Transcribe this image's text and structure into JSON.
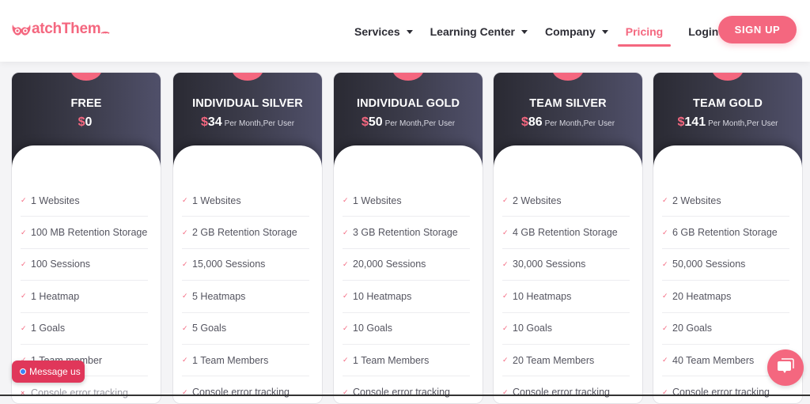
{
  "header": {
    "logo_text": "atchThem",
    "nav": [
      {
        "label": "Services",
        "has_dropdown": true,
        "active": false
      },
      {
        "label": "Learning Center",
        "has_dropdown": true,
        "active": false
      },
      {
        "label": "Company",
        "has_dropdown": true,
        "active": false
      },
      {
        "label": "Pricing",
        "has_dropdown": false,
        "active": true
      },
      {
        "label": "Login",
        "has_dropdown": false,
        "active": false
      }
    ],
    "signup_label": "SIGN UP"
  },
  "colors": {
    "accent": "#f4677f",
    "card_header_dark": "#2a2a33",
    "card_header_light": "#50506a",
    "message_button": "#e0375a"
  },
  "plans": [
    {
      "title": "FREE",
      "currency": "$",
      "price": "0",
      "period": "",
      "features": [
        {
          "text": "1 Websites",
          "included": true
        },
        {
          "text": "100 MB Retention Storage",
          "included": true
        },
        {
          "text": "100 Sessions",
          "included": true
        },
        {
          "text": "1 Heatmap",
          "included": true
        },
        {
          "text": "1 Goals",
          "included": true
        },
        {
          "text": "1 Team member",
          "included": true
        },
        {
          "text": "Console error tracking",
          "included": false
        }
      ]
    },
    {
      "title": "INDIVIDUAL SILVER",
      "currency": "$",
      "price": "34",
      "period": "Per Month,Per User",
      "features": [
        {
          "text": "1 Websites",
          "included": true
        },
        {
          "text": "2 GB Retention Storage",
          "included": true
        },
        {
          "text": "15,000 Sessions",
          "included": true
        },
        {
          "text": "5 Heatmaps",
          "included": true
        },
        {
          "text": "5 Goals",
          "included": true
        },
        {
          "text": "1 Team Members",
          "included": true
        },
        {
          "text": "Console error tracking",
          "included": true
        }
      ]
    },
    {
      "title": "INDIVIDUAL GOLD",
      "currency": "$",
      "price": "50",
      "period": "Per Month,Per User",
      "features": [
        {
          "text": "1 Websites",
          "included": true
        },
        {
          "text": "3 GB Retention Storage",
          "included": true
        },
        {
          "text": "20,000 Sessions",
          "included": true
        },
        {
          "text": "10 Heatmaps",
          "included": true
        },
        {
          "text": "10 Goals",
          "included": true
        },
        {
          "text": "1 Team Members",
          "included": true
        },
        {
          "text": "Console error tracking",
          "included": true
        }
      ]
    },
    {
      "title": "TEAM SILVER",
      "currency": "$",
      "price": "86",
      "period": "Per Month,Per User",
      "features": [
        {
          "text": "2 Websites",
          "included": true
        },
        {
          "text": "4 GB Retention Storage",
          "included": true
        },
        {
          "text": "30,000 Sessions",
          "included": true
        },
        {
          "text": "10 Heatmaps",
          "included": true
        },
        {
          "text": "10 Goals",
          "included": true
        },
        {
          "text": "20 Team Members",
          "included": true
        },
        {
          "text": "Console error tracking",
          "included": true
        }
      ]
    },
    {
      "title": "TEAM GOLD",
      "currency": "$",
      "price": "141",
      "period": "Per Month,Per User",
      "features": [
        {
          "text": "2 Websites",
          "included": true
        },
        {
          "text": "6 GB Retention Storage",
          "included": true
        },
        {
          "text": "50,000 Sessions",
          "included": true
        },
        {
          "text": "20 Heatmaps",
          "included": true
        },
        {
          "text": "20 Goals",
          "included": true
        },
        {
          "text": "40 Team Members",
          "included": true
        },
        {
          "text": "Console error tracking",
          "included": true
        }
      ]
    }
  ],
  "icons": {
    "check": "✓",
    "cross": "×"
  },
  "widgets": {
    "message_label": "Message us",
    "chat_icon": "chat-bubble-icon"
  }
}
